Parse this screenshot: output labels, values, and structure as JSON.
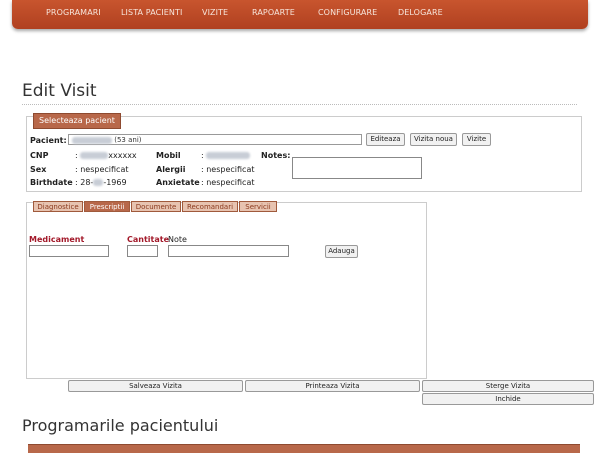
{
  "nav": {
    "items": [
      "PROGRAMARI",
      "LISTA PACIENTI",
      "VIZITE",
      "RAPOARTE",
      "CONFIGURARE",
      "DELOGARE"
    ]
  },
  "page": {
    "title": "Edit Visit"
  },
  "patient_section": {
    "select_button": "Selecteaza pacient",
    "patient_label": "Pacient:",
    "patient_age": "(53 ani)",
    "buttons": {
      "edit": "Editeaza",
      "new_visit": "Vizita noua",
      "visits": "Vizite"
    },
    "cnp_label": "CNP",
    "cnp_value": "xxxxxx",
    "mobil_label": "Mobil",
    "notes_label": "Notes:",
    "sex_label": "Sex",
    "sex_value": ": nespecificat",
    "alergii_label": "Alergii",
    "alergii_value": ": nespecificat",
    "birthdate_label": "Birthdate",
    "birthdate_prefix": ": 28-",
    "birthdate_year": "-1969",
    "anxietate_label": "Anxietate",
    "anxietate_value": ": nespecificat",
    "colon": ":"
  },
  "tabs": [
    "Diagnostice",
    "Prescriptii",
    "Documente",
    "Recomandari",
    "Servicii"
  ],
  "active_tab": "Prescriptii",
  "prescription_form": {
    "medicament_label": "Medicament",
    "cantitate_label": "Cantitate",
    "note_label": "Note",
    "add_button": "Adauga"
  },
  "actions": {
    "save": "Salveaza Vizita",
    "print": "Printeaza Vizita",
    "delete": "Sterge Vizita",
    "close": "Inchide"
  },
  "appointments": {
    "title": "Programarile pacientului"
  },
  "colors": {
    "nav": "#b84a26",
    "accent": "#b8684a",
    "label_red": "#a3192a"
  }
}
